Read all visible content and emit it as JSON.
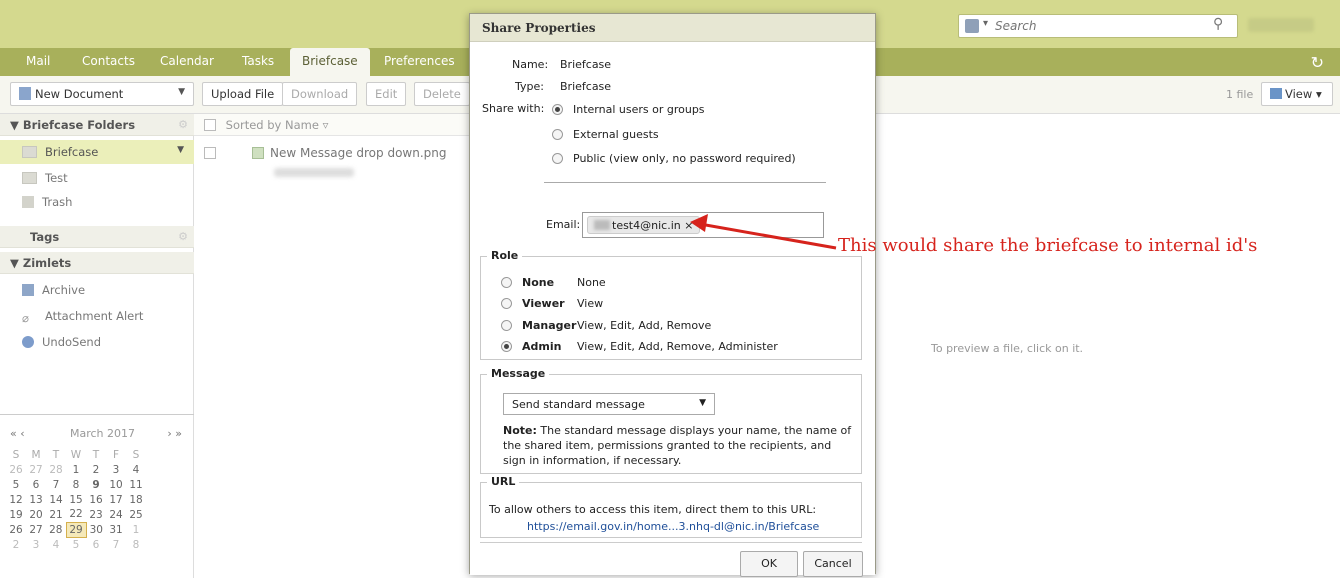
{
  "header": {
    "search_placeholder": "Search"
  },
  "tabs": [
    {
      "label": "Mail"
    },
    {
      "label": "Contacts"
    },
    {
      "label": "Calendar"
    },
    {
      "label": "Tasks"
    },
    {
      "label": "Briefcase"
    },
    {
      "label": "Preferences"
    }
  ],
  "toolbar": {
    "new_document": "New Document",
    "upload_file": "Upload File",
    "download": "Download",
    "edit": "Edit",
    "delete": "Delete",
    "file_count": "1 file",
    "view": "View"
  },
  "sidebar": {
    "briefcase_folders_header": "Briefcase Folders",
    "folders": [
      {
        "label": "Briefcase"
      },
      {
        "label": "Test"
      },
      {
        "label": "Trash"
      }
    ],
    "tags_header": "Tags",
    "zimlets_header": "Zimlets",
    "zimlets": [
      {
        "label": "Archive"
      },
      {
        "label": "Attachment Alert"
      },
      {
        "label": "UndoSend"
      }
    ]
  },
  "calendar": {
    "title": "March 2017",
    "weekday_headers": [
      "S",
      "M",
      "T",
      "W",
      "T",
      "F",
      "S"
    ],
    "weeks": [
      [
        "26",
        "27",
        "28",
        "1",
        "2",
        "3",
        "4"
      ],
      [
        "5",
        "6",
        "7",
        "8",
        "9",
        "10",
        "11"
      ],
      [
        "12",
        "13",
        "14",
        "15",
        "16",
        "17",
        "18"
      ],
      [
        "19",
        "20",
        "21",
        "22",
        "23",
        "24",
        "25"
      ],
      [
        "26",
        "27",
        "28",
        "29",
        "30",
        "31",
        "1"
      ],
      [
        "2",
        "3",
        "4",
        "5",
        "6",
        "7",
        "8"
      ]
    ],
    "today": "29"
  },
  "list": {
    "sort_label": "Sorted by Name",
    "files": [
      {
        "name": "New Message drop down.png"
      }
    ]
  },
  "preview": {
    "hint": "To preview a file, click on it."
  },
  "dialog": {
    "title": "Share Properties",
    "name_label": "Name:",
    "name_value": "Briefcase",
    "type_label": "Type:",
    "type_value": "Briefcase",
    "share_with_label": "Share with:",
    "share_options": [
      {
        "label": "Internal users or groups",
        "checked": true
      },
      {
        "label": "External guests",
        "checked": false
      },
      {
        "label": "Public (view only, no password required)",
        "checked": false
      }
    ],
    "email_label": "Email:",
    "email_chip": "test4@nic.in",
    "role_legend": "Role",
    "roles": [
      {
        "name": "None",
        "desc": "None",
        "checked": false
      },
      {
        "name": "Viewer",
        "desc": "View",
        "checked": false
      },
      {
        "name": "Manager",
        "desc": "View, Edit, Add, Remove",
        "checked": false
      },
      {
        "name": "Admin",
        "desc": "View, Edit, Add, Remove, Administer",
        "checked": true
      }
    ],
    "message_legend": "Message",
    "message_select": "Send standard message",
    "note_bold": "Note:",
    "note_text": " The standard message displays your name, the name of the shared item, permissions granted to the recipients, and sign in information, if necessary.",
    "url_legend": "URL",
    "url_instructions": "To allow others to access this item, direct them to this URL:",
    "url_link": "https://email.gov.in/home...3.nhq-dl@nic.in/Briefcase",
    "ok": "OK",
    "cancel": "Cancel"
  },
  "annotation": {
    "text": "This would share the briefcase to internal id's",
    "color": "#d6231c"
  }
}
